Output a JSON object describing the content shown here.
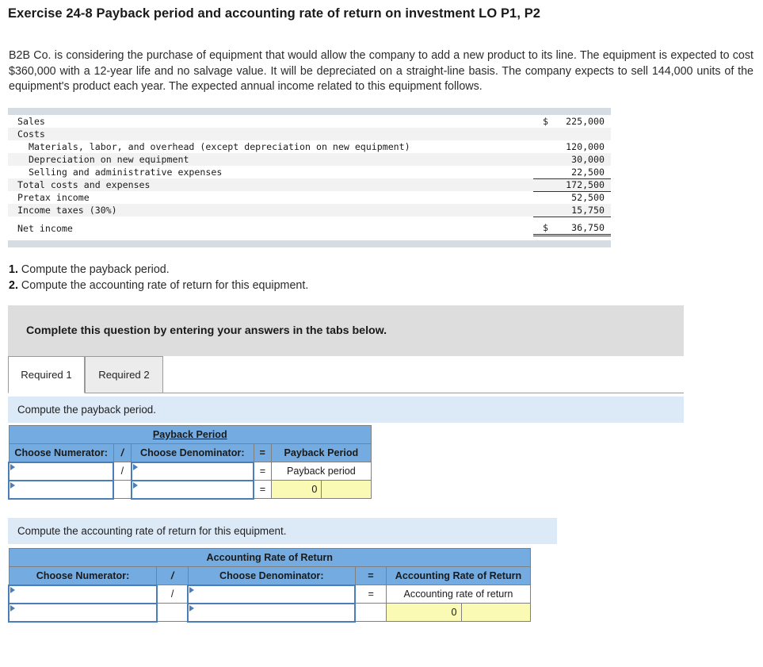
{
  "title": "Exercise 24-8 Payback period and accounting rate of return on investment LO P1, P2",
  "problem": "B2B Co. is considering the purchase of equipment that would allow the company to add a new product to its line. The equipment is expected to cost $360,000 with a 12-year life and no salvage value. It will be depreciated on a straight-line basis. The company expects to sell 144,000 units of the equipment's product each year. The expected annual income related to this equipment follows.",
  "income_statement": {
    "rows": [
      {
        "label": "Sales",
        "symbol": "$",
        "amount": "225,000"
      },
      {
        "label": "Costs",
        "symbol": "",
        "amount": ""
      },
      {
        "label": "Materials, labor, and overhead (except depreciation on new equipment)",
        "symbol": "",
        "amount": "120,000"
      },
      {
        "label": "Depreciation on new equipment",
        "symbol": "",
        "amount": "30,000"
      },
      {
        "label": "Selling and administrative expenses",
        "symbol": "",
        "amount": "22,500"
      },
      {
        "label": "Total costs and expenses",
        "symbol": "",
        "amount": "172,500"
      },
      {
        "label": "Pretax income",
        "symbol": "",
        "amount": "52,500"
      },
      {
        "label": "Income taxes (30%)",
        "symbol": "",
        "amount": "15,750"
      },
      {
        "label": "Net income",
        "symbol": "$",
        "amount": "36,750"
      }
    ]
  },
  "requirements": {
    "item1_num": "1.",
    "item1_text": "Compute the payback period.",
    "item2_num": "2.",
    "item2_text": "Compute the accounting rate of return for this equipment."
  },
  "complete_banner": "Complete this question by entering your answers in the tabs below.",
  "tabs": [
    {
      "label": "Required 1",
      "active": true
    },
    {
      "label": "Required 2",
      "active": false
    }
  ],
  "payback": {
    "instruction": "Compute the payback period.",
    "title": "Payback Period",
    "header": {
      "numerator": "Choose Numerator:",
      "slash": "/",
      "denominator": "Choose Denominator:",
      "equals": "=",
      "result": "Payback Period"
    },
    "row1": {
      "numerator_value": "",
      "slash": "/",
      "denominator_value": "",
      "equals": "=",
      "result_label": "Payback period"
    },
    "row2": {
      "numerator_value": "",
      "slash": "",
      "denominator_value": "",
      "equals": "=",
      "result_value": "0"
    }
  },
  "arr": {
    "instruction": "Compute the accounting rate of return for this equipment.",
    "title": "Accounting Rate of Return",
    "header": {
      "numerator": "Choose Numerator:",
      "slash": "/",
      "denominator": "Choose Denominator:",
      "equals": "=",
      "result": "Accounting Rate of Return"
    },
    "row1": {
      "numerator_value": "",
      "slash": "/",
      "denominator_value": "",
      "equals": "=",
      "result_label": "Accounting rate of return"
    },
    "row2": {
      "numerator_value": "",
      "slash": "",
      "denominator_value": "",
      "equals": "",
      "result_value": "0"
    }
  },
  "colors": {
    "header_blue": "#74ace2",
    "instruction_blue": "#dce9f7",
    "banner_gray": "#dddddd",
    "answer_yellow": "#fafab4",
    "table_bar": "#d5dce4"
  }
}
